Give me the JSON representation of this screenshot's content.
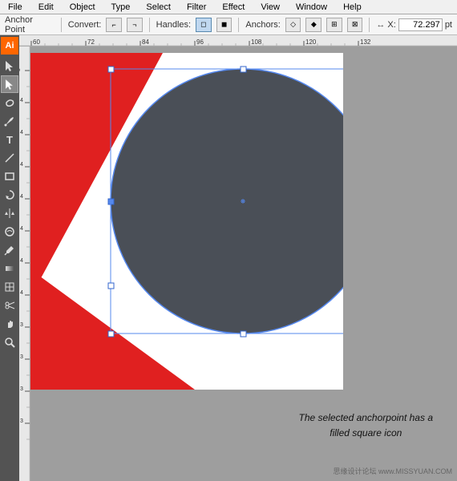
{
  "menubar": {
    "items": [
      "File",
      "Edit",
      "Object",
      "Type",
      "Select",
      "Filter",
      "Effect",
      "View",
      "Window",
      "Help"
    ]
  },
  "optionsbar": {
    "label_anchor": "Anchor Point",
    "label_convert": "Convert:",
    "label_handles": "Handles:",
    "label_anchors": "Anchors:",
    "x_label": "X:",
    "x_value": "72.297",
    "x_unit": "pt"
  },
  "toolbar": {
    "tools": [
      {
        "name": "select-tool",
        "icon": "▲",
        "active": false
      },
      {
        "name": "direct-select-tool",
        "icon": "↖",
        "active": true
      },
      {
        "name": "pen-tool",
        "icon": "✒",
        "active": false
      },
      {
        "name": "type-tool",
        "icon": "T",
        "active": false
      },
      {
        "name": "line-tool",
        "icon": "/",
        "active": false
      },
      {
        "name": "rectangle-tool",
        "icon": "▭",
        "active": false
      },
      {
        "name": "rotate-tool",
        "icon": "↻",
        "active": false
      },
      {
        "name": "reflect-tool",
        "icon": "⇆",
        "active": false
      },
      {
        "name": "scale-tool",
        "icon": "⊞",
        "active": false
      },
      {
        "name": "blend-tool",
        "icon": "◎",
        "active": false
      },
      {
        "name": "eyedropper-tool",
        "icon": "⊿",
        "active": false
      },
      {
        "name": "gradient-tool",
        "icon": "■",
        "active": false
      },
      {
        "name": "mesh-tool",
        "icon": "⊞",
        "active": false
      },
      {
        "name": "scissors-tool",
        "icon": "✂",
        "active": false
      },
      {
        "name": "hand-tool",
        "icon": "✋",
        "active": false
      },
      {
        "name": "zoom-tool",
        "icon": "🔍",
        "active": false
      }
    ]
  },
  "canvas": {
    "annotation_line1": "The selected anchorpoint has a",
    "annotation_line2": "filled square icon",
    "watermark": "思缘设计论坛 www.MISSYUAN.COM"
  },
  "ruler": {
    "top_marks": [
      "60",
      "72",
      "84",
      "96",
      "108",
      "120",
      "132"
    ],
    "left_marks": [
      "5",
      "4",
      "4",
      "4",
      "4",
      "4",
      "4",
      "4",
      "4",
      "4",
      "3",
      "3"
    ]
  }
}
